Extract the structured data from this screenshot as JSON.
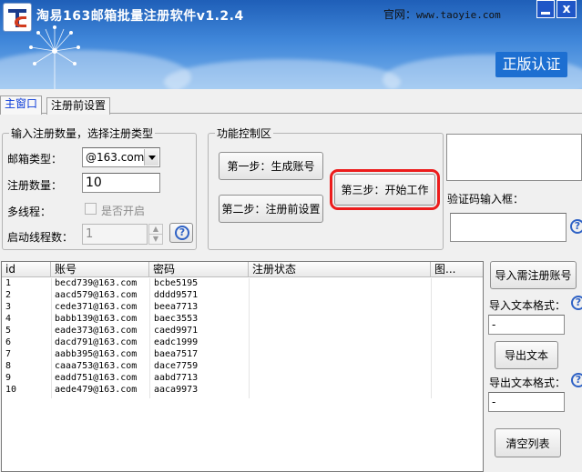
{
  "header": {
    "title": "淘易163邮箱批量注册软件v1.2.4",
    "website_label": "官网：",
    "website_url": "www.taoyie.com",
    "close_glyph": "x",
    "auth_badge": "正版认证"
  },
  "tabs": [
    {
      "label": "主窗口",
      "active": true
    },
    {
      "label": "注册前设置",
      "active": false
    }
  ],
  "input_group": {
    "title": "输入注册数量，选择注册类型",
    "mailbox_type_label": "邮箱类型：",
    "mailbox_type_value": "@163.com",
    "count_label": "注册数量：",
    "count_value": "10",
    "multithread_label": "多线程：",
    "multithread_checkbox_label": "是否开启",
    "multithread_enabled": false,
    "threads_label": "启动线程数：",
    "threads_value": "1",
    "help_glyph": "?"
  },
  "control_group": {
    "title": "功能控制区",
    "step1_label": "第一步：生成账号",
    "step2_label": "第二步：注册前设置",
    "step3_label": "第三步：开始工作"
  },
  "captcha": {
    "label": "验证码输入框：",
    "value": ""
  },
  "table": {
    "columns": [
      "id",
      "账号",
      "密码",
      "注册状态",
      "图..."
    ],
    "rows": [
      [
        "1",
        "becd739@163.com",
        "bcbe5195",
        ""
      ],
      [
        "2",
        "aacd579@163.com",
        "dddd9571",
        ""
      ],
      [
        "3",
        "cede371@163.com",
        "beea7713",
        ""
      ],
      [
        "4",
        "babb139@163.com",
        "baec3553",
        ""
      ],
      [
        "5",
        "eade373@163.com",
        "caed9971",
        ""
      ],
      [
        "6",
        "dacd791@163.com",
        "eadc1999",
        ""
      ],
      [
        "7",
        "aabb395@163.com",
        "baea7517",
        ""
      ],
      [
        "8",
        "caaa753@163.com",
        "dace7759",
        ""
      ],
      [
        "9",
        "eadd751@163.com",
        "aabd7713",
        ""
      ],
      [
        "10",
        "aede479@163.com",
        "aaca9973",
        ""
      ]
    ]
  },
  "side_panel": {
    "import_button": "导入需注册账号",
    "import_format_label": "导入文本格式：",
    "import_format_value": "-",
    "export_button": "导出文本",
    "export_format_label": "导出文本格式：",
    "export_format_value": "-",
    "clear_button": "清空列表"
  },
  "colors": {
    "banner_top": "#1f5fb8",
    "banner_bottom": "#79b2ec",
    "active_tab_text": "#0a3ad8",
    "highlight_outline": "#ec1c1c",
    "auth_badge_bg": "#1d6fd1"
  },
  "icons": {
    "app_logo": "app-logo-icon",
    "help": "question-icon",
    "minimize": "minimize-icon",
    "close": "close-icon"
  }
}
